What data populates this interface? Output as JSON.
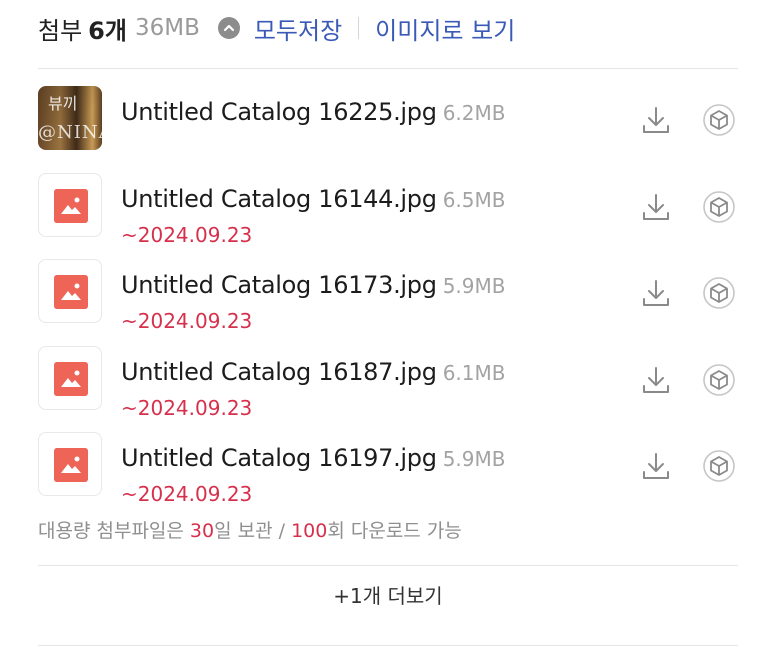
{
  "header": {
    "label": "첨부",
    "count": "6개",
    "total_size": "36MB",
    "save_all": "모두저장",
    "view_images": "이미지로 보기"
  },
  "files": [
    {
      "name": "Untitled Catalog 16225.jpg",
      "size": "6.2MB",
      "expiry": "",
      "thumb": "photo",
      "watermark_top": "뷰끼",
      "watermark_bottom": "@NINA"
    },
    {
      "name": "Untitled Catalog 16144.jpg",
      "size": "6.5MB",
      "expiry": "~2024.09.23",
      "thumb": "image-icon"
    },
    {
      "name": "Untitled Catalog 16173.jpg",
      "size": "5.9MB",
      "expiry": "~2024.09.23",
      "thumb": "image-icon"
    },
    {
      "name": "Untitled Catalog 16187.jpg",
      "size": "6.1MB",
      "expiry": "~2024.09.23",
      "thumb": "image-icon"
    },
    {
      "name": "Untitled Catalog 16197.jpg",
      "size": "5.9MB",
      "expiry": "~2024.09.23",
      "thumb": "image-icon"
    }
  ],
  "notice": {
    "part1": "대용량 첨부파일은 ",
    "days": "30",
    "part2": "일 보관 / ",
    "downloads": "100",
    "part3": "회 다운로드 가능"
  },
  "more_button": "+1개 더보기",
  "colors": {
    "link": "#3a5ab8",
    "expiry": "#d6304c",
    "image_badge": "#ee6457",
    "muted": "#a3a3a3"
  },
  "icons": {
    "toggle": "chevron-up-icon",
    "download": "download-icon",
    "cloud_save": "cube-icon",
    "file_type": "image-file-icon"
  }
}
